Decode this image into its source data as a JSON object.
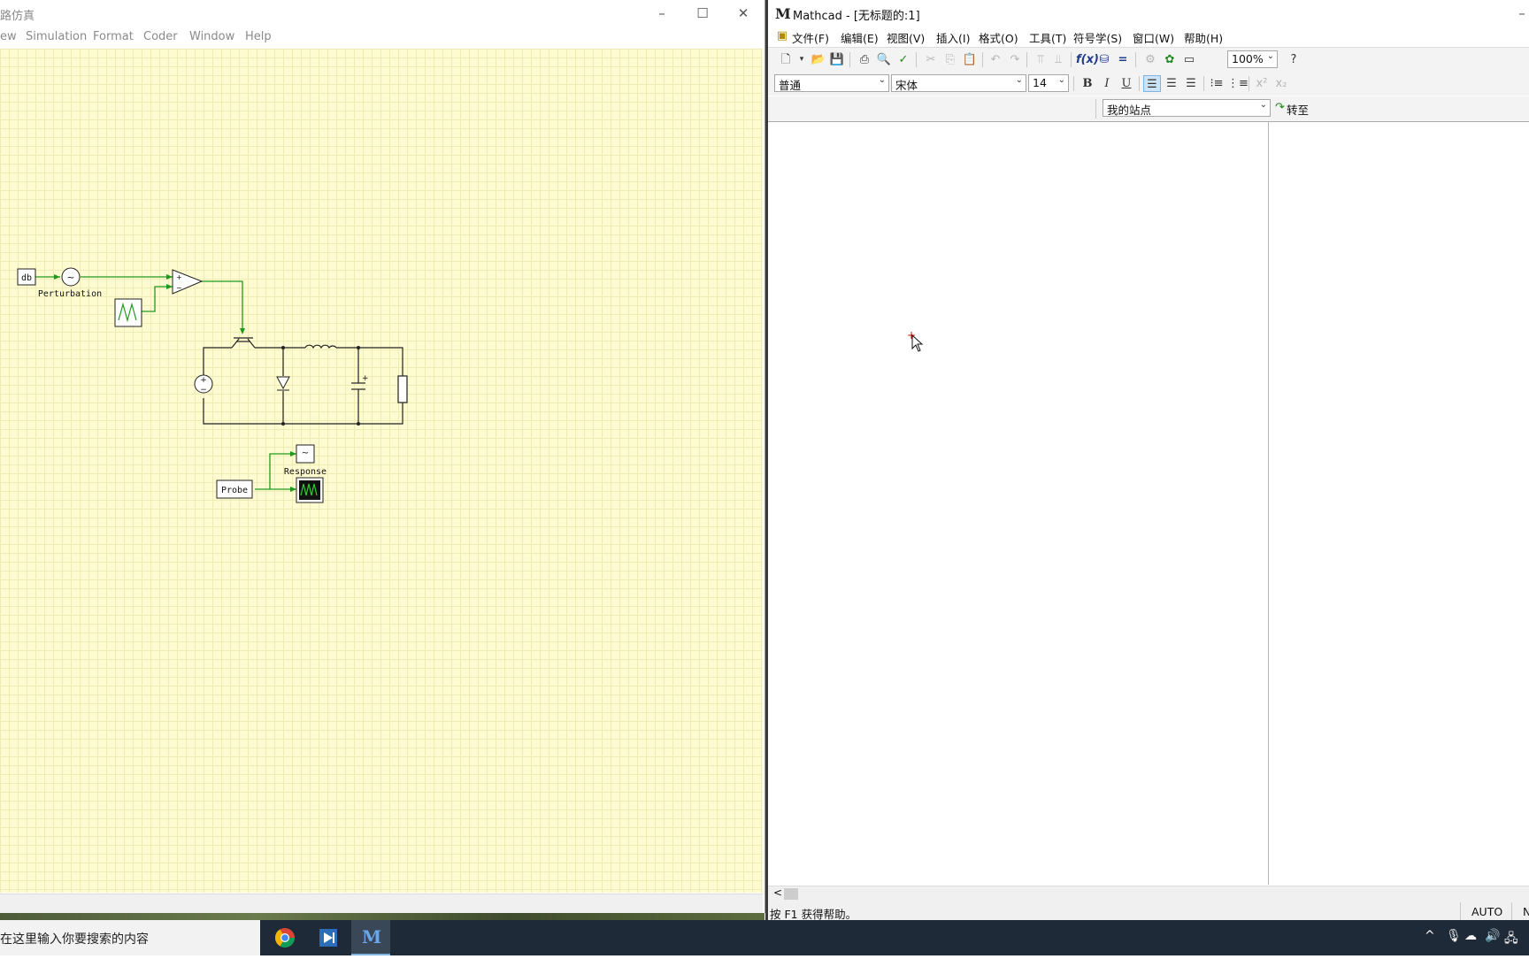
{
  "left_window": {
    "title": "路仿真",
    "menu": [
      "ew",
      "Simulation",
      "Format",
      "Coder",
      "Window",
      "Help"
    ],
    "controls": {
      "minimize": "–",
      "maximize": "☐",
      "close": "✕"
    },
    "schematic": {
      "db_label": "db",
      "perturbation_label": "Perturbation",
      "probe_label": "Probe",
      "response_label": "Response",
      "tilde": "~"
    }
  },
  "mathcad": {
    "title": "Mathcad - [无标题的:1]",
    "logo": "M",
    "menu": [
      "文件(F)",
      "编辑(E)",
      "视图(V)",
      "插入(I)",
      "格式(O)",
      "工具(T)",
      "符号学(S)",
      "窗口(W)",
      "帮助(H)"
    ],
    "zoom": "100%",
    "style": "普通",
    "font": "宋体",
    "size": "14",
    "bold": "B",
    "italic": "I",
    "underline": "U",
    "url": "我的站点",
    "go_label": "转至",
    "status_text": "按 F1 获得帮助。",
    "status_mode": "AUTO",
    "status_extra": "N",
    "window_minimize": "–",
    "scroll_left": "<"
  },
  "taskbar": {
    "search_placeholder": "在这里输入你要搜索的内容",
    "apps": [
      "chrome-app",
      "plecs-app",
      "mathcad-app"
    ]
  }
}
